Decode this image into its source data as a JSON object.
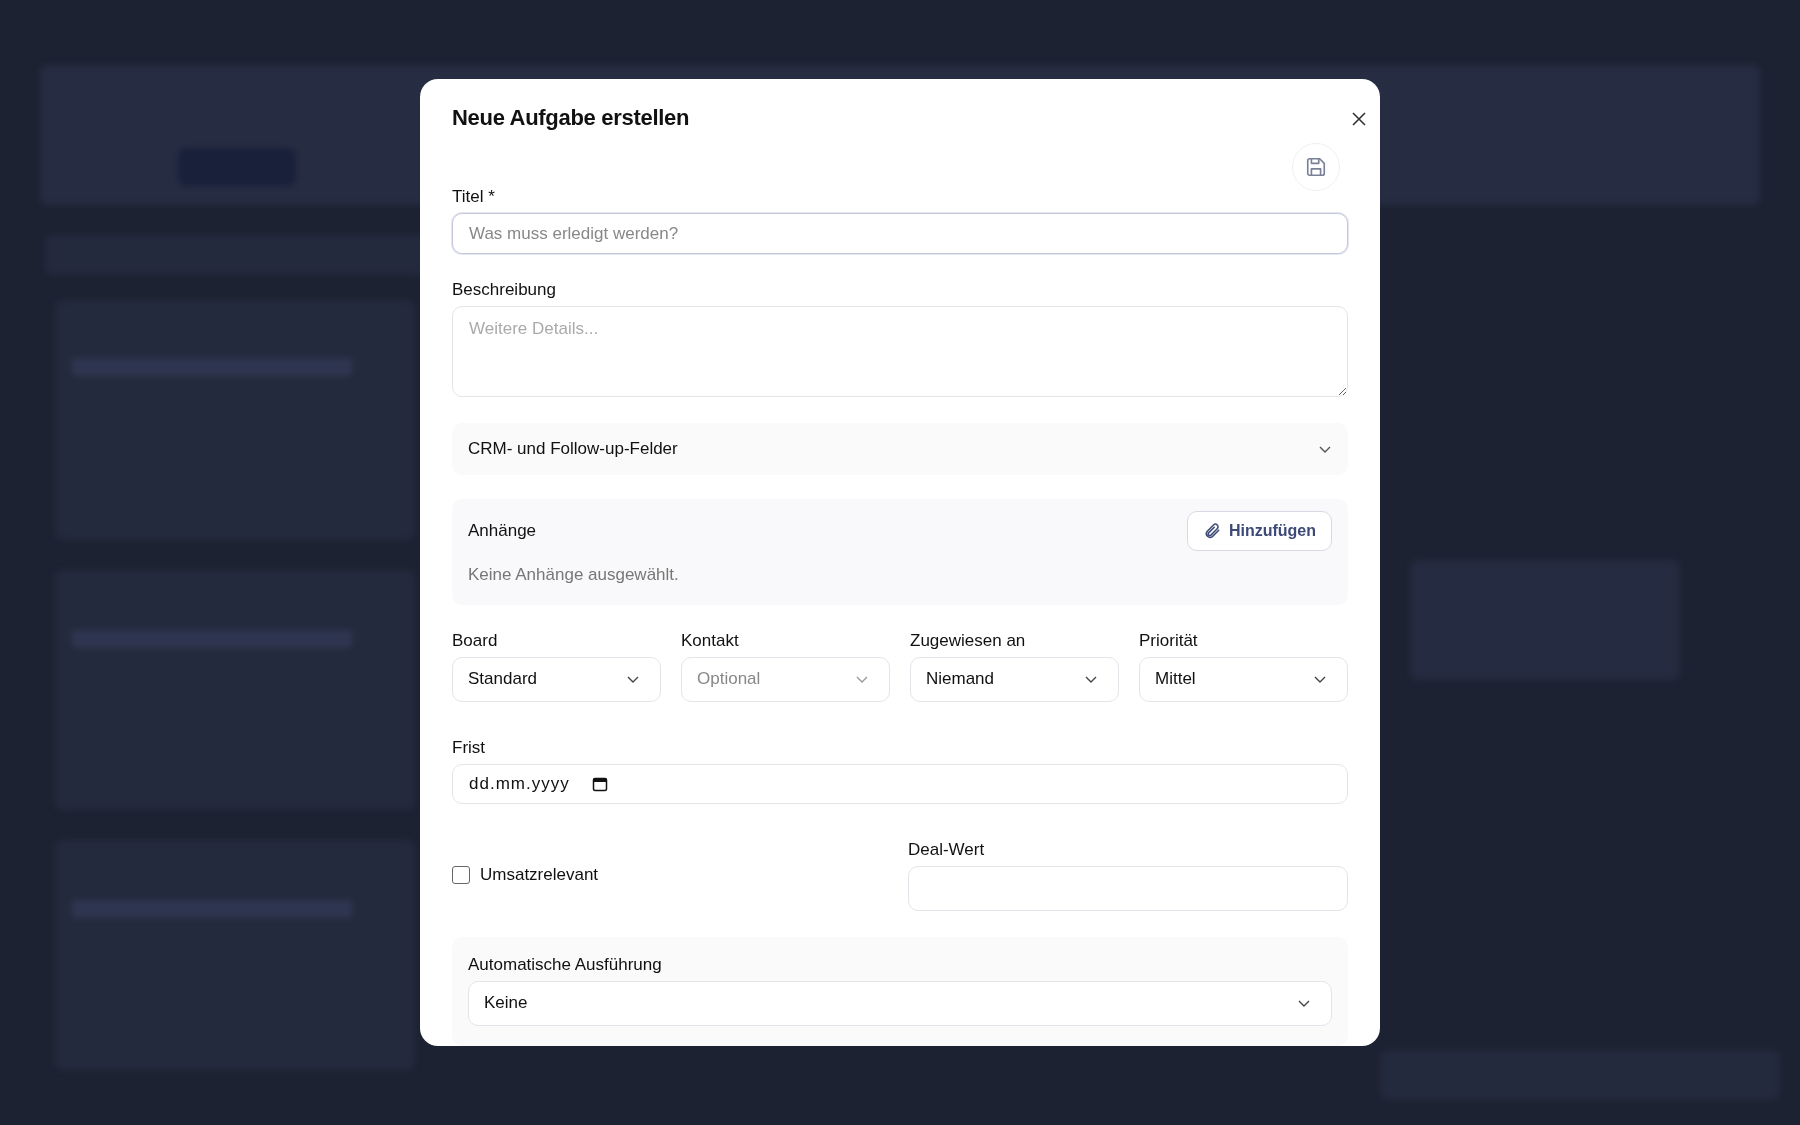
{
  "dialog": {
    "title": "Neue Aufgabe erstellen"
  },
  "title_field": {
    "label": "Titel *",
    "placeholder": "Was muss erledigt werden?"
  },
  "description_field": {
    "label": "Beschreibung",
    "placeholder": "Weitere Details..."
  },
  "crm_section": {
    "label": "CRM- und Follow-up-Felder",
    "expanded": false
  },
  "attachments": {
    "label": "Anhänge",
    "button": "Hinzufügen",
    "empty_text": "Keine Anhänge ausgewählt."
  },
  "selects": [
    {
      "label": "Board",
      "value": "Standard"
    },
    {
      "label": "Kontakt",
      "placeholder": "Optional"
    },
    {
      "label": "Zugewiesen an",
      "value": "Niemand"
    },
    {
      "label": "Priorität",
      "value": "Mittel"
    }
  ],
  "due_field": {
    "label": "Frist",
    "placeholder": "dd.mm.yyyy"
  },
  "revenue_checkbox": {
    "label": "Umsatzrelevant",
    "checked": false
  },
  "deal_field": {
    "label": "Deal-Wert"
  },
  "automation": {
    "label": "Automatische Ausführung",
    "value": "Keine"
  }
}
